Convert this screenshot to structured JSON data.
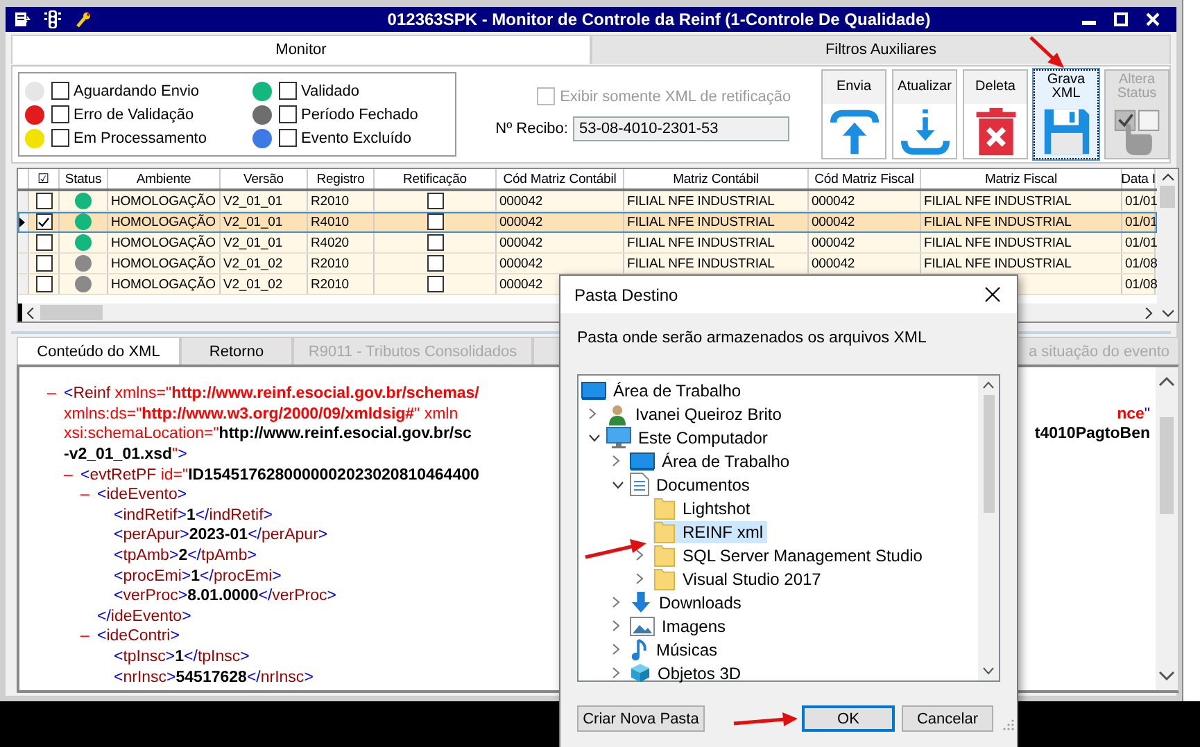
{
  "window": {
    "title": "012363SPK - Monitor de Controle da Reinf (1-Controle De Qualidade)"
  },
  "tabs": [
    {
      "label": "Monitor",
      "selected": true
    },
    {
      "label": "Filtros Auxiliares",
      "selected": false
    }
  ],
  "legend": [
    {
      "label": "Aguardando Envio",
      "color": "#e6e6e6",
      "checked": false
    },
    {
      "label": "Validado",
      "color": "#14b87e",
      "checked": false
    },
    {
      "label": "Erro de Validação",
      "color": "#e41b1b",
      "checked": false
    },
    {
      "label": "Período Fechado",
      "color": "#6e6e6e",
      "checked": false
    },
    {
      "label": "Em Processamento",
      "color": "#f2e200",
      "checked": false
    },
    {
      "label": "Evento Excluído",
      "color": "#3d7ae6",
      "checked": false
    }
  ],
  "retificacao_filter": {
    "label": "Exibir somente XML de retificação",
    "checked": false,
    "disabled": true
  },
  "recibo": {
    "label": "Nº Recibo:",
    "value": "53-08-4010-2301-53"
  },
  "actions": [
    {
      "label": "Envia",
      "kind": "upload",
      "focused": false,
      "disabled": false
    },
    {
      "label": "Atualizar",
      "kind": "download",
      "focused": false,
      "disabled": false
    },
    {
      "label": "Deleta",
      "kind": "delete",
      "focused": false,
      "disabled": false
    },
    {
      "label": "Grava XML",
      "kind": "save",
      "focused": true,
      "disabled": false
    },
    {
      "label": "Altera Status",
      "kind": "status",
      "focused": false,
      "disabled": true
    }
  ],
  "grid": {
    "select_all": "☑",
    "columns": [
      "Status",
      "Ambiente",
      "Versão",
      "Registro",
      "Retificação",
      "Cód Matriz Contábil",
      "Matriz Contábil",
      "Cód Matriz Fiscal",
      "Matriz Fiscal",
      "Data I"
    ],
    "rows": [
      {
        "checked": false,
        "selected": false,
        "cells": [
          {
            "kind": "status",
            "color": "#14b87e"
          },
          {
            "kind": "text",
            "text": "HOMOLOGAÇÃO"
          },
          {
            "kind": "text",
            "text": "V2_01_01"
          },
          {
            "kind": "text",
            "text": "R2010"
          },
          {
            "kind": "checkbox",
            "checked": false
          },
          {
            "kind": "text",
            "text": "000042"
          },
          {
            "kind": "text",
            "text": "FILIAL NFE INDUSTRIAL"
          },
          {
            "kind": "text",
            "text": "000042"
          },
          {
            "kind": "text",
            "text": "FILIAL NFE INDUSTRIAL"
          },
          {
            "kind": "text",
            "text": "01/01"
          }
        ]
      },
      {
        "checked": true,
        "selected": true,
        "cells": [
          {
            "kind": "status",
            "color": "#14b87e"
          },
          {
            "kind": "text",
            "text": "HOMOLOGAÇÃO"
          },
          {
            "kind": "text",
            "text": "V2_01_01"
          },
          {
            "kind": "text",
            "text": "R4010"
          },
          {
            "kind": "checkbox",
            "checked": false
          },
          {
            "kind": "text",
            "text": "000042"
          },
          {
            "kind": "text",
            "text": "FILIAL NFE INDUSTRIAL"
          },
          {
            "kind": "text",
            "text": "000042"
          },
          {
            "kind": "text",
            "text": "FILIAL NFE INDUSTRIAL"
          },
          {
            "kind": "text",
            "text": "01/01"
          }
        ]
      },
      {
        "checked": false,
        "selected": false,
        "cells": [
          {
            "kind": "status",
            "color": "#14b87e"
          },
          {
            "kind": "text",
            "text": "HOMOLOGAÇÃO"
          },
          {
            "kind": "text",
            "text": "V2_01_01"
          },
          {
            "kind": "text",
            "text": "R4020"
          },
          {
            "kind": "checkbox",
            "checked": false
          },
          {
            "kind": "text",
            "text": "000042"
          },
          {
            "kind": "text",
            "text": "FILIAL NFE INDUSTRIAL"
          },
          {
            "kind": "text",
            "text": "000042"
          },
          {
            "kind": "text",
            "text": "FILIAL NFE INDUSTRIAL"
          },
          {
            "kind": "text",
            "text": "01/01"
          }
        ]
      },
      {
        "checked": false,
        "selected": false,
        "cells": [
          {
            "kind": "status",
            "color": "#8a8a8a"
          },
          {
            "kind": "text",
            "text": "HOMOLOGAÇÃO"
          },
          {
            "kind": "text",
            "text": "V2_01_02"
          },
          {
            "kind": "text",
            "text": "R2010"
          },
          {
            "kind": "checkbox",
            "checked": false
          },
          {
            "kind": "text",
            "text": "000042"
          },
          {
            "kind": "text",
            "text": "FILIAL NFE INDUSTRIAL"
          },
          {
            "kind": "text",
            "text": "000042"
          },
          {
            "kind": "text",
            "text": "FILIAL NFE INDUSTRIAL"
          },
          {
            "kind": "text",
            "text": "01/08"
          }
        ]
      },
      {
        "checked": false,
        "selected": false,
        "cells": [
          {
            "kind": "status",
            "color": "#8a8a8a"
          },
          {
            "kind": "text",
            "text": "HOMOLOGAÇÃO"
          },
          {
            "kind": "text",
            "text": "V2_01_02"
          },
          {
            "kind": "text",
            "text": "R2010"
          },
          {
            "kind": "checkbox",
            "checked": false
          },
          {
            "kind": "text",
            "text": "000042"
          },
          null,
          null,
          null,
          {
            "kind": "text",
            "text": "01/08"
          }
        ]
      }
    ]
  },
  "lower_tabs": [
    {
      "label": "Conteúdo do XML",
      "selected": true,
      "disabled": false
    },
    {
      "label": "Retorno",
      "selected": false,
      "disabled": false
    },
    {
      "label": "R9011 - Tributos Consolidados",
      "selected": false,
      "disabled": true
    },
    {
      "label": "a situação do evento",
      "selected": false,
      "disabled": true
    }
  ],
  "xml": [
    {
      "toggle": "–",
      "rows": [
        {
          "segs": [
            {
              "kind": "punct",
              "text": "<"
            },
            {
              "kind": "tag",
              "text": "Reinf"
            },
            {
              "kind": "attr",
              "text": " xmlns=\""
            },
            {
              "kind": "ns",
              "text": "http://www.reinf.esocial.gov.br/schemas/"
            }
          ]
        },
        {
          "segs": [
            {
              "kind": "attr",
              "text": "xmlns:ds=\""
            },
            {
              "kind": "ns",
              "text": "http://www.w3.org/2000/09/xmldsig#"
            },
            {
              "kind": "attr",
              "text": "\" xmln"
            }
          ],
          "right": [
            {
              "kind": "ns",
              "text": "nce"
            },
            {
              "kind": "punct",
              "text": "\""
            }
          ]
        },
        {
          "segs": [
            {
              "kind": "attr",
              "text": "xsi:schemaLocation=\""
            },
            {
              "kind": "value",
              "text": "http://www.reinf.esocial.gov.br/sc"
            }
          ],
          "right": [
            {
              "kind": "value",
              "text": "t4010PagtoBen"
            }
          ]
        },
        {
          "segs": [
            {
              "kind": "value",
              "text": "-v2_01_01.xsd"
            },
            {
              "kind": "attr",
              "text": "\""
            },
            {
              "kind": "punct",
              "text": ">"
            }
          ]
        }
      ],
      "children": [
        {
          "toggle": "–",
          "rows": [
            {
              "segs": [
                {
                  "kind": "punct",
                  "text": "<"
                },
                {
                  "kind": "tag",
                  "text": "evtRetPF"
                },
                {
                  "kind": "attr",
                  "text": " id=\""
                },
                {
                  "kind": "value",
                  "text": "ID1545176280000002023020810464400"
                }
              ]
            }
          ],
          "children": [
            {
              "toggle": "–",
              "rows": [
                {
                  "segs": [
                    {
                      "kind": "punct",
                      "text": "<"
                    },
                    {
                      "kind": "tag",
                      "text": "ideEvento"
                    },
                    {
                      "kind": "punct",
                      "text": ">"
                    }
                  ]
                }
              ],
              "children": [
                {
                  "rows": [
                    {
                      "segs": [
                        {
                          "kind": "punct",
                          "text": "<"
                        },
                        {
                          "kind": "tag",
                          "text": "indRetif"
                        },
                        {
                          "kind": "punct",
                          "text": ">"
                        },
                        {
                          "kind": "value",
                          "text": "1"
                        },
                        {
                          "kind": "punct",
                          "text": "</"
                        },
                        {
                          "kind": "tag",
                          "text": "indRetif"
                        },
                        {
                          "kind": "punct",
                          "text": ">"
                        }
                      ]
                    }
                  ]
                },
                {
                  "rows": [
                    {
                      "segs": [
                        {
                          "kind": "punct",
                          "text": "<"
                        },
                        {
                          "kind": "tag",
                          "text": "perApur"
                        },
                        {
                          "kind": "punct",
                          "text": ">"
                        },
                        {
                          "kind": "value",
                          "text": "2023-01"
                        },
                        {
                          "kind": "punct",
                          "text": "</"
                        },
                        {
                          "kind": "tag",
                          "text": "perApur"
                        },
                        {
                          "kind": "punct",
                          "text": ">"
                        }
                      ]
                    }
                  ]
                },
                {
                  "rows": [
                    {
                      "segs": [
                        {
                          "kind": "punct",
                          "text": "<"
                        },
                        {
                          "kind": "tag",
                          "text": "tpAmb"
                        },
                        {
                          "kind": "punct",
                          "text": ">"
                        },
                        {
                          "kind": "value",
                          "text": "2"
                        },
                        {
                          "kind": "punct",
                          "text": "</"
                        },
                        {
                          "kind": "tag",
                          "text": "tpAmb"
                        },
                        {
                          "kind": "punct",
                          "text": ">"
                        }
                      ]
                    }
                  ]
                },
                {
                  "rows": [
                    {
                      "segs": [
                        {
                          "kind": "punct",
                          "text": "<"
                        },
                        {
                          "kind": "tag",
                          "text": "procEmi"
                        },
                        {
                          "kind": "punct",
                          "text": ">"
                        },
                        {
                          "kind": "value",
                          "text": "1"
                        },
                        {
                          "kind": "punct",
                          "text": "</"
                        },
                        {
                          "kind": "tag",
                          "text": "procEmi"
                        },
                        {
                          "kind": "punct",
                          "text": ">"
                        }
                      ]
                    }
                  ]
                },
                {
                  "rows": [
                    {
                      "segs": [
                        {
                          "kind": "punct",
                          "text": "<"
                        },
                        {
                          "kind": "tag",
                          "text": "verProc"
                        },
                        {
                          "kind": "punct",
                          "text": ">"
                        },
                        {
                          "kind": "value",
                          "text": "8.01.0000"
                        },
                        {
                          "kind": "punct",
                          "text": "</"
                        },
                        {
                          "kind": "tag",
                          "text": "verProc"
                        },
                        {
                          "kind": "punct",
                          "text": ">"
                        }
                      ]
                    }
                  ]
                }
              ],
              "close": [
                {
                  "kind": "punct",
                  "text": "</"
                },
                {
                  "kind": "tag",
                  "text": "ideEvento"
                },
                {
                  "kind": "punct",
                  "text": ">"
                }
              ]
            },
            {
              "toggle": "–",
              "rows": [
                {
                  "segs": [
                    {
                      "kind": "punct",
                      "text": "<"
                    },
                    {
                      "kind": "tag",
                      "text": "ideContri"
                    },
                    {
                      "kind": "punct",
                      "text": ">"
                    }
                  ]
                }
              ],
              "children": [
                {
                  "rows": [
                    {
                      "segs": [
                        {
                          "kind": "punct",
                          "text": "<"
                        },
                        {
                          "kind": "tag",
                          "text": "tpInsc"
                        },
                        {
                          "kind": "punct",
                          "text": ">"
                        },
                        {
                          "kind": "value",
                          "text": "1"
                        },
                        {
                          "kind": "punct",
                          "text": "</"
                        },
                        {
                          "kind": "tag",
                          "text": "tpInsc"
                        },
                        {
                          "kind": "punct",
                          "text": ">"
                        }
                      ]
                    }
                  ]
                },
                {
                  "rows": [
                    {
                      "segs": [
                        {
                          "kind": "punct",
                          "text": "<"
                        },
                        {
                          "kind": "tag",
                          "text": "nrInsc"
                        },
                        {
                          "kind": "punct",
                          "text": ">"
                        },
                        {
                          "kind": "value",
                          "text": "54517628"
                        },
                        {
                          "kind": "punct",
                          "text": "</"
                        },
                        {
                          "kind": "tag",
                          "text": "nrInsc"
                        },
                        {
                          "kind": "punct",
                          "text": ">"
                        }
                      ]
                    }
                  ]
                }
              ]
            }
          ]
        }
      ]
    }
  ],
  "dialog": {
    "title": "Pasta Destino",
    "message": "Pasta onde serão armazenados os arquivos XML",
    "tree": [
      {
        "label": "Área de Trabalho",
        "kind": "desktop",
        "selected": false,
        "children": [
          {
            "label": "Ivanei Queiroz Brito",
            "kind": "user",
            "selected": false,
            "expanded": false
          },
          {
            "label": "Este Computador",
            "kind": "computer",
            "selected": false,
            "expanded": true,
            "children": [
              {
                "label": "Área de Trabalho",
                "kind": "desktop",
                "selected": false,
                "expanded": false
              },
              {
                "label": "Documentos",
                "kind": "document",
                "selected": false,
                "expanded": true,
                "children": [
                  {
                    "label": "Lightshot",
                    "kind": "folder",
                    "selected": false
                  },
                  {
                    "label": "REINF xml",
                    "kind": "folder",
                    "selected": true
                  },
                  {
                    "label": "SQL Server Management Studio",
                    "kind": "folder",
                    "selected": false,
                    "expanded": false
                  },
                  {
                    "label": "Visual Studio 2017",
                    "kind": "folder",
                    "selected": false,
                    "expanded": false
                  }
                ]
              },
              {
                "label": "Downloads",
                "kind": "download",
                "selected": false,
                "expanded": false
              },
              {
                "label": "Imagens",
                "kind": "image",
                "selected": false,
                "expanded": false
              },
              {
                "label": "Músicas",
                "kind": "music",
                "selected": false,
                "expanded": false
              },
              {
                "label": "Objetos 3D",
                "kind": "cube",
                "selected": false,
                "expanded": false
              }
            ]
          }
        ]
      }
    ],
    "buttons": [
      {
        "label": "Criar Nova Pasta",
        "default": false
      },
      {
        "label": "OK",
        "default": true
      },
      {
        "label": "Cancelar",
        "default": false
      }
    ]
  }
}
